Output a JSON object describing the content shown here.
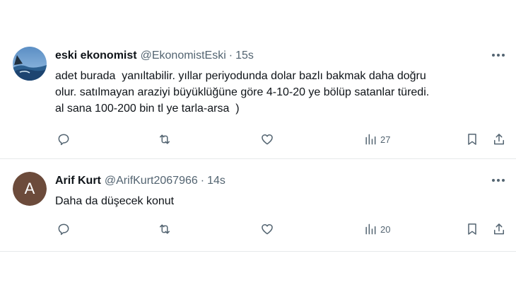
{
  "tweets": [
    {
      "name": "eski ekonomist",
      "handle": "@EkonomistEski",
      "separator": "·",
      "time": "15s",
      "text_lines": [
        "adet burada  yanıltabilir. yıllar periyodunda dolar bazlı bakmak daha doğru",
        "olur. satılmayan araziyi büyüklüğüne göre 4-10-20 ye bölüp satanlar türedi.",
        "al sana 100-200 bin tl ye tarla-arsa  )"
      ],
      "views": "27",
      "avatar_icon": "ocean-landscape-avatar"
    },
    {
      "name": "Arif Kurt",
      "handle": "@ArifKurt2067966",
      "separator": "·",
      "time": "14s",
      "text_lines": [
        "Daha da düşecek konut"
      ],
      "views": "20",
      "avatar_letter": "A",
      "avatar_color": "#6c4b3b"
    }
  ],
  "icons": [
    "more-icon",
    "reply-icon",
    "retweet-icon",
    "like-icon",
    "views-icon",
    "bookmark-icon",
    "share-icon"
  ],
  "colors": {
    "text": "#0f1419",
    "secondary": "#536471",
    "divider": "#e6e9ea"
  }
}
